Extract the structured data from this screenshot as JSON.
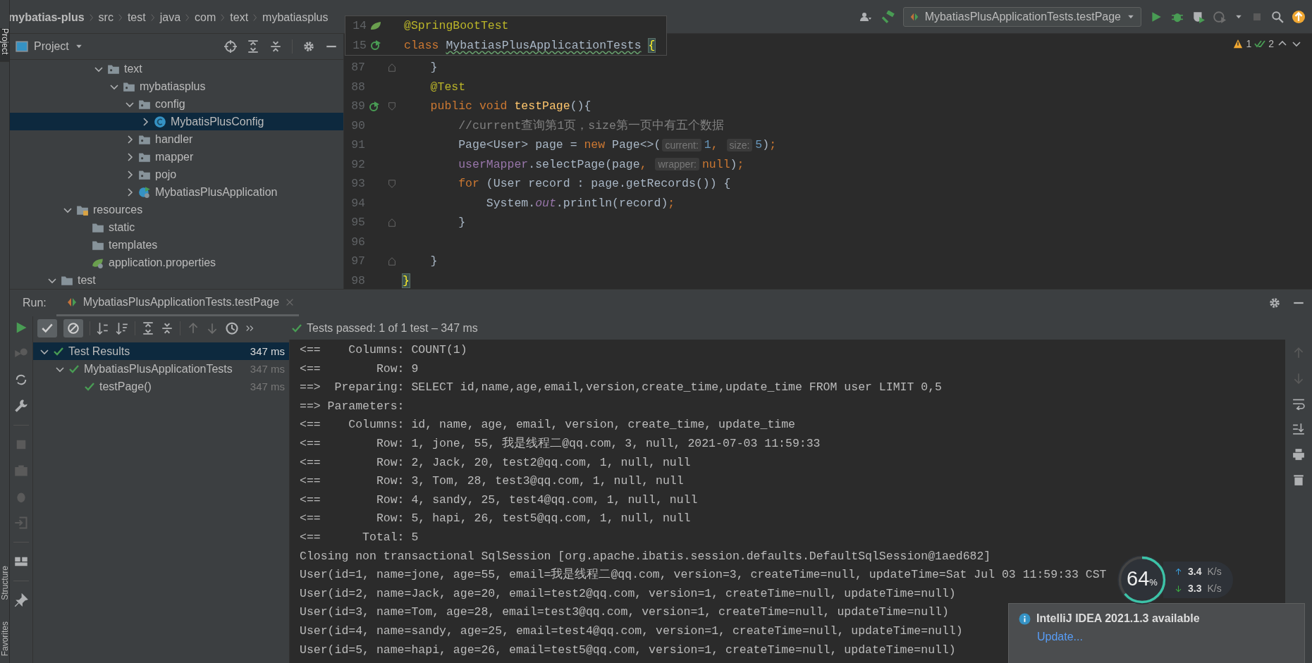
{
  "breadcrumbs": [
    {
      "text": "mybatias-plus",
      "bold": true
    },
    {
      "text": "src",
      "bold": false
    },
    {
      "text": "test",
      "bold": false
    },
    {
      "text": "java",
      "bold": false
    },
    {
      "text": "com",
      "bold": false
    },
    {
      "text": "text",
      "bold": false
    },
    {
      "text": "mybatiasplus",
      "bold": false
    }
  ],
  "toolbar": {
    "run_config": "MybatiasPlusApplicationTests.testPage"
  },
  "stripe": {
    "top": [
      {
        "label": "Project",
        "selected": true
      }
    ],
    "bottom": [
      {
        "label": "Structure",
        "selected": false
      },
      {
        "label": "Favorites",
        "selected": false
      }
    ]
  },
  "project": {
    "title": "Project",
    "tree": [
      {
        "label": "text",
        "kind": "package",
        "expanded": true,
        "selected": false,
        "children": [
          {
            "label": "mybatiasplus",
            "kind": "package",
            "expanded": true,
            "selected": false,
            "children": [
              {
                "label": "config",
                "kind": "package",
                "expanded": true,
                "selected": false,
                "children": [
                  {
                    "label": "MybatisPlusConfig",
                    "kind": "class",
                    "expanded": false,
                    "selected": true
                  }
                ]
              },
              {
                "label": "handler",
                "kind": "package",
                "expanded": false,
                "selected": false
              },
              {
                "label": "mapper",
                "kind": "package",
                "expanded": false,
                "selected": false
              },
              {
                "label": "pojo",
                "kind": "package",
                "expanded": false,
                "selected": false
              },
              {
                "label": "MybatiasPlusApplication",
                "kind": "spring-app",
                "expanded": false,
                "selected": false
              }
            ]
          }
        ]
      },
      {
        "label": "resources",
        "kind": "resources",
        "expanded": true,
        "selected": false,
        "children": [
          {
            "label": "static",
            "kind": "folder",
            "selected": false
          },
          {
            "label": "templates",
            "kind": "folder",
            "selected": false
          },
          {
            "label": "application.properties",
            "kind": "properties",
            "selected": false
          }
        ]
      },
      {
        "label": "test",
        "kind": "folder",
        "expanded": true,
        "selected": false
      }
    ]
  },
  "editor": {
    "sticky": [
      {
        "number": "14",
        "gutter_icon": {
          "kind": "bean"
        },
        "tokens": [
          {
            "kind": "annotation",
            "text": "@SpringBootTest"
          }
        ]
      },
      {
        "number": "15",
        "gutter_icon": {
          "kind": "run"
        },
        "tokens": [
          {
            "kind": "keyword",
            "text": "class "
          },
          {
            "kind": "typo",
            "text": "MybatiasPlusApplicationTests"
          },
          {
            "kind": "brace-match",
            "text": "{"
          }
        ]
      }
    ],
    "lines": [
      {
        "number": "87",
        "fold_marker": {
          "kind": "end"
        },
        "tokens": [
          {
            "kind": "plain",
            "text": "    }"
          }
        ]
      },
      {
        "number": "88",
        "tokens": [
          {
            "kind": "annotation",
            "text": "    @Test"
          }
        ]
      },
      {
        "number": "89",
        "gutter_icon": {
          "kind": "run"
        },
        "fold_marker": {
          "kind": "start"
        },
        "tokens": [
          {
            "kind": "keyword",
            "text": "    public void "
          },
          {
            "kind": "method",
            "text": "testPage"
          },
          {
            "kind": "plain",
            "text": "(){"
          }
        ]
      },
      {
        "number": "90",
        "tokens": [
          {
            "kind": "comment",
            "text": "        //current查询第1页，size第一页中有五个数据"
          }
        ]
      },
      {
        "number": "91",
        "tokens": [
          {
            "kind": "plain",
            "text": "        Page<User> page = "
          },
          {
            "kind": "keyword",
            "text": "new "
          },
          {
            "kind": "plain",
            "text": "Page<>("
          },
          {
            "kind": "hint",
            "text": "current:"
          },
          {
            "kind": "number",
            "text": "1"
          },
          {
            "kind": "keyword",
            "text": ", "
          },
          {
            "kind": "hint",
            "text": "size:"
          },
          {
            "kind": "number",
            "text": "5"
          },
          {
            "kind": "plain",
            "text": ")"
          },
          {
            "kind": "keyword",
            "text": ";"
          }
        ]
      },
      {
        "number": "92",
        "tokens": [
          {
            "kind": "field",
            "text": "        userMapper"
          },
          {
            "kind": "plain",
            "text": ".selectPage(page"
          },
          {
            "kind": "keyword",
            "text": ", "
          },
          {
            "kind": "hint",
            "text": "wrapper:"
          },
          {
            "kind": "keyword",
            "text": "null"
          },
          {
            "kind": "plain",
            "text": ")"
          },
          {
            "kind": "keyword",
            "text": ";"
          }
        ]
      },
      {
        "number": "93",
        "fold_marker": {
          "kind": "start"
        },
        "tokens": [
          {
            "kind": "keyword",
            "text": "        for "
          },
          {
            "kind": "plain",
            "text": "(User record : page.getRecords()) {"
          }
        ]
      },
      {
        "number": "94",
        "tokens": [
          {
            "kind": "plain",
            "text": "            System."
          },
          {
            "kind": "static",
            "text": "out"
          },
          {
            "kind": "plain",
            "text": ".println(record)"
          },
          {
            "kind": "keyword",
            "text": ";"
          }
        ]
      },
      {
        "number": "95",
        "fold_marker": {
          "kind": "end"
        },
        "tokens": [
          {
            "kind": "plain",
            "text": "        }"
          }
        ]
      },
      {
        "number": "96"
      },
      {
        "number": "97",
        "fold_marker": {
          "kind": "end"
        },
        "tokens": [
          {
            "kind": "plain",
            "text": "    }"
          }
        ]
      },
      {
        "number": "98",
        "tokens": [
          {
            "kind": "brace-match",
            "text": "}"
          }
        ]
      }
    ],
    "inspections": {
      "warnings": "1",
      "weak_warnings": "2"
    }
  },
  "run": {
    "label": "Run:",
    "tab": "MybatiasPlusApplicationTests.testPage",
    "toggles": [
      {
        "kind": "show-passed",
        "on": true
      },
      {
        "kind": "show-ignored",
        "on": true
      }
    ],
    "status": "Tests passed: 1 of 1 test – 347 ms",
    "tests": [
      {
        "label": "Test Results",
        "time": "347 ms",
        "passed": true,
        "expanded": true,
        "selected": true,
        "children": [
          {
            "label": "MybatiasPlusApplicationTests",
            "time": "347 ms",
            "passed": true,
            "expanded": true,
            "selected": false,
            "children": [
              {
                "label": "testPage()",
                "time": "347 ms",
                "passed": true,
                "selected": false
              }
            ]
          }
        ]
      }
    ],
    "console": [
      "<==    Columns: COUNT(1)",
      "<==        Row: 9",
      "==>  Preparing: SELECT id,name,age,email,version,create_time,update_time FROM user LIMIT 0,5",
      "==> Parameters: ",
      "<==    Columns: id, name, age, email, version, create_time, update_time",
      "<==        Row: 1, jone, 55, 我是线程二@qq.com, 3, null, 2021-07-03 11:59:33",
      "<==        Row: 2, Jack, 20, test2@qq.com, 1, null, null",
      "<==        Row: 3, Tom, 28, test3@qq.com, 1, null, null",
      "<==        Row: 4, sandy, 25, test4@qq.com, 1, null, null",
      "<==        Row: 5, hapi, 26, test5@qq.com, 1, null, null",
      "<==      Total: 5",
      "Closing non transactional SqlSession [org.apache.ibatis.session.defaults.DefaultSqlSession@1aed682]",
      "User(id=1, name=jone, age=55, email=我是线程二@qq.com, version=3, createTime=null, updateTime=Sat Jul 03 11:59:33 CST",
      "User(id=2, name=Jack, age=20, email=test2@qq.com, version=1, createTime=null, updateTime=null)",
      "User(id=3, name=Tom, age=28, email=test3@qq.com, version=1, createTime=null, updateTime=null)",
      "User(id=4, name=sandy, age=25, email=test4@qq.com, version=1, createTime=null, updateTime=null)",
      "User(id=5, name=hapi, age=26, email=test5@qq.com, version=1, createTime=null, updateTime=null)"
    ]
  },
  "network": {
    "load": "64",
    "unit": "%",
    "up": "3.4",
    "up_unit": "K/s",
    "down": "3.3",
    "down_unit": "K/s"
  },
  "notification": {
    "title": "IntelliJ IDEA 2021.1.3 available",
    "link": "Update..."
  }
}
